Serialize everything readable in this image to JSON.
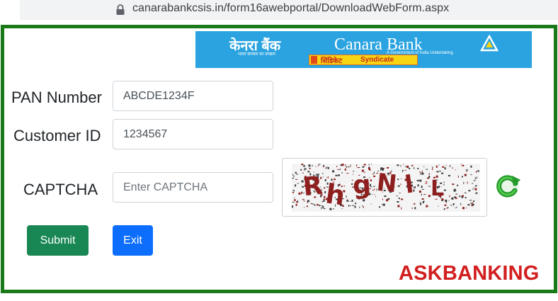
{
  "browser": {
    "url": "canarabankcsis.in/form16awebportal/DownloadWebForm.aspx",
    "lock_icon": "lock-icon"
  },
  "logo": {
    "hindi_name": "केनरा बैंक",
    "english_name": "Canara Bank",
    "hindi_tagline": "भारत सरकार का उपक्रम",
    "english_tagline": "A Government of India Undertaking",
    "merger_hindi": "सिंडिकेट",
    "merger_english": "Syndicate"
  },
  "form": {
    "pan_label": "PAN Number",
    "pan_value": "ABCDE1234F",
    "customer_id_label": "Customer ID",
    "customer_id_value": "1234567",
    "captcha_label": "CAPTCHA",
    "captcha_placeholder": "Enter CAPTCHA",
    "captcha_text": "RhgNl L",
    "refresh_icon": "refresh-icon"
  },
  "buttons": {
    "submit_label": "Submit",
    "exit_label": "Exit"
  },
  "watermark": "ASKBANKING",
  "colors": {
    "frame_border": "#1a7a1a",
    "logo_bg": "#2aa3e0",
    "submit_bg": "#198754",
    "exit_bg": "#0d6efd",
    "captcha_text": "#8e1f1f",
    "watermark": "#d21f1f"
  }
}
